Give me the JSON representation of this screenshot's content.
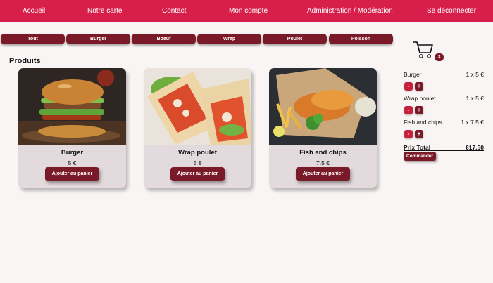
{
  "nav": {
    "items": [
      "Accueil",
      "Notre carte",
      "Contact",
      "Mon compte",
      "Administration / Modération",
      "Se déconnecter"
    ]
  },
  "filters": [
    "Tout",
    "Burger",
    "Boeuf",
    "Wrap",
    "Poulet",
    "Poisson"
  ],
  "products_title": "Produits",
  "products": [
    {
      "name": "Burger",
      "price": "5 €",
      "button": "Ajouter au panier"
    },
    {
      "name": "Wrap poulet",
      "price": "5 €",
      "button": "Ajouter au panier"
    },
    {
      "name": "Fish and chips",
      "price": "7.5 €",
      "button": "Ajouter au panier"
    }
  ],
  "cart": {
    "count": "3",
    "items": [
      {
        "name": "Burger",
        "qty": "1 x 5 €",
        "minus": "-",
        "plus": "+"
      },
      {
        "name": "Wrap poulet",
        "qty": "1 x 5 €",
        "minus": "-",
        "plus": "+"
      },
      {
        "name": "Fish and chips",
        "qty": "1 x 7.5 €",
        "minus": "-",
        "plus": "+"
      }
    ],
    "total_label": "Prix Total",
    "total_value": "€17.50",
    "order_label": "Commander"
  },
  "colors": {
    "nav": "#d81f4b",
    "button": "#7a1a28",
    "card": "#e2dadd",
    "background": "#f9f5f4"
  }
}
